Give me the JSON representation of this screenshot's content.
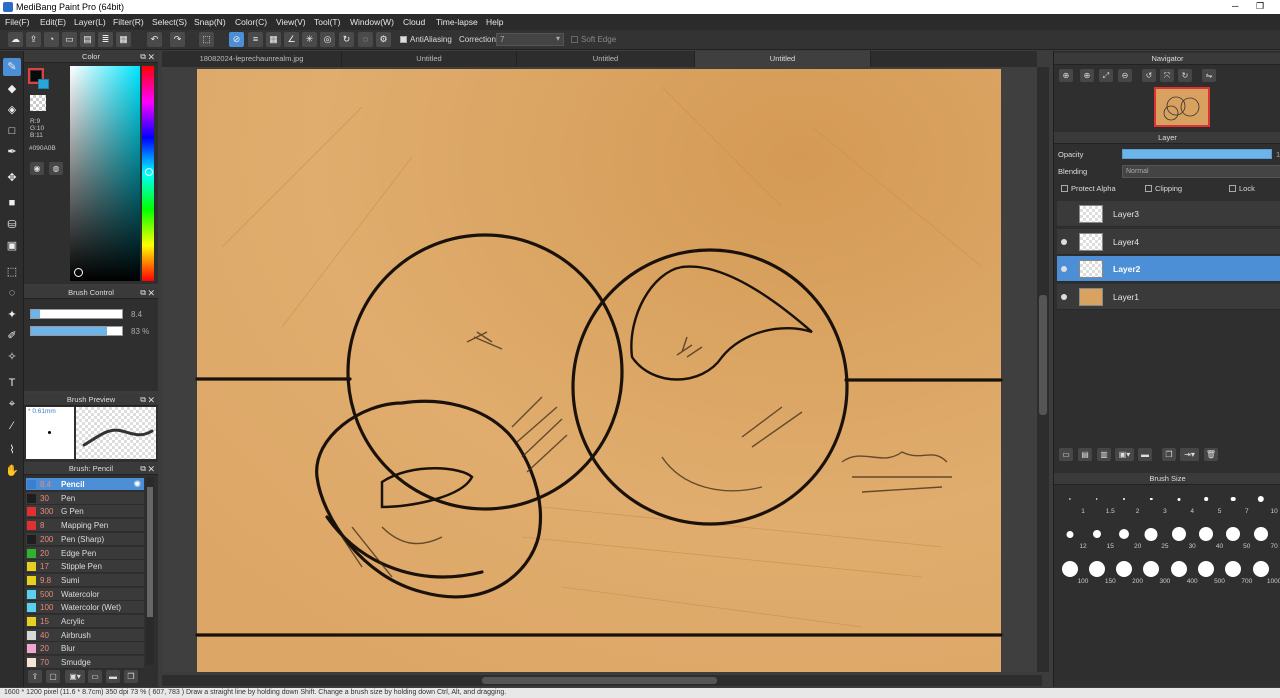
{
  "window": {
    "title": "MediBang Paint Pro (64bit)",
    "maximize_glyph": "❐",
    "minimize_glyph": "─"
  },
  "menu": [
    "File(F)",
    "Edit(E)",
    "Layer(L)",
    "Filter(R)",
    "Select(S)",
    "Snap(N)",
    "Color(C)",
    "View(V)",
    "Tool(T)",
    "Window(W)",
    "Cloud",
    "Time-lapse",
    "Help"
  ],
  "toolbar": {
    "antialiasing_label": "AntiAliasing",
    "correction_label": "Correction",
    "correction_value": "7",
    "soft_edge_label": "Soft Edge"
  },
  "tabs": [
    "18082024-leprechaunrealm.jpg",
    "Untitled",
    "Untitled",
    "Untitled"
  ],
  "color_panel": {
    "title": "Color",
    "r": "R:9",
    "g": "G:10",
    "b": "B:11",
    "hex": "#090A0B",
    "fg": "#090A0B",
    "bg": "#ffffff"
  },
  "brush_control": {
    "title": "Brush Control",
    "size_value": "8.4",
    "opacity_value": "83 %",
    "size_fraction": 0.1,
    "opacity_fraction": 0.83
  },
  "brush_preview": {
    "title": "Brush Preview",
    "size_text": "* 0.61mm"
  },
  "brush_list": {
    "title": "Brush: Pencil",
    "items": [
      {
        "size": "8.4",
        "name": "Pencil",
        "color": "#3a7fd0"
      },
      {
        "size": "30",
        "name": "Pen",
        "color": "#1e1e1e"
      },
      {
        "size": "300",
        "name": "G Pen",
        "color": "#e03030"
      },
      {
        "size": "8",
        "name": "Mapping Pen",
        "color": "#e03030"
      },
      {
        "size": "200",
        "name": "Pen (Sharp)",
        "color": "#1e1e1e"
      },
      {
        "size": "20",
        "name": "Edge Pen",
        "color": "#2db32d"
      },
      {
        "size": "17",
        "name": "Stipple Pen",
        "color": "#e8d020"
      },
      {
        "size": "9.8",
        "name": "Sumi",
        "color": "#e8d020"
      },
      {
        "size": "500",
        "name": "Watercolor",
        "color": "#5ad0f0"
      },
      {
        "size": "100",
        "name": "Watercolor (Wet)",
        "color": "#5ad0f0"
      },
      {
        "size": "15",
        "name": "Acrylic",
        "color": "#e8d020"
      },
      {
        "size": "40",
        "name": "Airbrush",
        "color": "#d8d8d8"
      },
      {
        "size": "20",
        "name": "Blur",
        "color": "#f0a8d0"
      },
      {
        "size": "70",
        "name": "Smudge",
        "color": "#f4e6d0"
      }
    ]
  },
  "navigator": {
    "title": "Navigator"
  },
  "layer_panel": {
    "title": "Layer",
    "opacity_label": "Opacity",
    "opacity_value": "100",
    "blending_label": "Blending",
    "blending_value": "Normal",
    "protect_alpha": "Protect Alpha",
    "clipping": "Clipping",
    "lock": "Lock",
    "layers": [
      {
        "name": "Layer3",
        "visible": false,
        "selected": false,
        "fill": "checker"
      },
      {
        "name": "Layer4",
        "visible": true,
        "selected": false,
        "fill": "checker"
      },
      {
        "name": "Layer2",
        "visible": true,
        "selected": true,
        "fill": "checker"
      },
      {
        "name": "Layer1",
        "visible": true,
        "selected": false,
        "fill": "#d9a25f"
      }
    ]
  },
  "brush_size": {
    "title": "Brush Size",
    "sizes": [
      "1",
      "1.5",
      "2",
      "3",
      "4",
      "5",
      "7",
      "10",
      "12",
      "15",
      "20",
      "25",
      "30",
      "40",
      "50",
      "70",
      "100",
      "150",
      "200",
      "300",
      "400",
      "500",
      "700",
      "1000"
    ]
  },
  "status": {
    "text": "1600 * 1200 pixel   (11.6 * 8.7cm)   350 dpi   73 %   ( 607, 783 )   Draw a straight line by holding down Shift. Change a brush size by holding down Ctrl, Alt, and dragging."
  },
  "colors": {
    "accent": "#4c8fd6",
    "canvas": "#d9a25f",
    "panel": "#2f2f2f"
  }
}
